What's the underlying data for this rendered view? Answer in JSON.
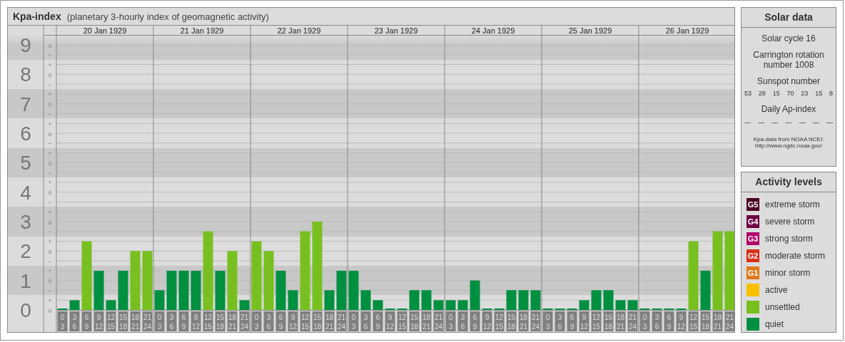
{
  "title": "Kpa-index",
  "subtitle": "(planetary 3-hourly index of geomagnetic activity)",
  "chart": {
    "days": [
      "20 Jan 1929",
      "21 Jan 1929",
      "22 Jan 1929",
      "23 Jan 1929",
      "24 Jan 1929",
      "25 Jan 1929",
      "26 Jan 1929"
    ],
    "scale_marks": [
      "o",
      "−",
      "+",
      "o",
      "−",
      "+",
      "o",
      "−",
      "+",
      "o",
      "−",
      "+",
      "o",
      "−",
      "+",
      "o",
      "−",
      "+",
      "o",
      "−",
      "+",
      "o",
      "−",
      "+",
      "o",
      "−",
      "+",
      "o"
    ],
    "chart_data": {
      "type": "bar",
      "stacked": true,
      "grid": true,
      "ylim": [
        0,
        9
      ],
      "yticks": [
        0,
        1,
        2,
        3,
        4,
        5,
        6,
        7,
        8,
        9
      ],
      "categories": [
        "0 3",
        "3 6",
        "6 9",
        "9 12",
        "12 15",
        "15 18",
        "18 21",
        "21 24",
        "0 3",
        "3 6",
        "6 9",
        "9 12",
        "12 15",
        "15 18",
        "18 21",
        "21 24",
        "0 3",
        "3 6",
        "6 9",
        "9 12",
        "12 15",
        "15 18",
        "18 21",
        "21 24",
        "0 3",
        "3 6",
        "6 9",
        "9 12",
        "12 15",
        "15 18",
        "18 21",
        "21 24",
        "0 3",
        "3 6",
        "6 9",
        "9 12",
        "12 15",
        "15 18",
        "18 21",
        "21 24",
        "0 3",
        "3 6",
        "6 9",
        "9 12",
        "12 15",
        "15 18",
        "18 21",
        "21 24",
        "0 3",
        "3 6",
        "6 9",
        "9 12",
        "12 15",
        "15 18",
        "18 21",
        "21 24"
      ],
      "series": [
        {
          "color": "#009040",
          "values": [
            0,
            0.33,
            null,
            1.33,
            0.33,
            1.33,
            null,
            null,
            0.67,
            1.33,
            1.33,
            1.33,
            null,
            1.33,
            null,
            0.33,
            null,
            null,
            1.33,
            0.67,
            null,
            null,
            0.67,
            1.33,
            1.33,
            0.67,
            0.33,
            0,
            0,
            0.67,
            0.67,
            0.33,
            0.33,
            0.33,
            1,
            0,
            0,
            0.67,
            0.67,
            0.67,
            0,
            0,
            0,
            0.33,
            0.67,
            0.67,
            0.33,
            0.33,
            0,
            0,
            0,
            0,
            null,
            1.33,
            null,
            null
          ]
        },
        {
          "color": "#78c020",
          "values": [
            null,
            null,
            2.33,
            null,
            null,
            null,
            2,
            2,
            null,
            null,
            null,
            null,
            2.67,
            null,
            2,
            null,
            2.33,
            2,
            null,
            null,
            2.67,
            3,
            null,
            null,
            null,
            null,
            null,
            null,
            null,
            null,
            null,
            null,
            null,
            null,
            null,
            null,
            null,
            null,
            null,
            null,
            null,
            null,
            null,
            null,
            null,
            null,
            null,
            null,
            null,
            null,
            null,
            null,
            2.33,
            null,
            2.67,
            2.67
          ]
        }
      ]
    }
  },
  "solar": {
    "title": "Solar data",
    "cycle": "Solar cycle 16",
    "rotation": "Carrington rotation number 1008",
    "sunspot_title": "Sunspot number",
    "sunspots": [
      "53",
      "28",
      "15",
      "70",
      "23",
      "15",
      "8"
    ],
    "ap_title": "Daily Ap-index",
    "ap_values": [
      "—",
      "—",
      "—",
      "—",
      "—",
      "—",
      "—"
    ],
    "source": [
      "Kpa-data from NOAA NCEI:",
      "http://www.ngdc.noaa.gov/"
    ]
  },
  "legend": {
    "title": "Activity levels",
    "items": [
      {
        "badge": "G5",
        "label": "extreme storm",
        "color": "#4a0022"
      },
      {
        "badge": "G4",
        "label": "severe storm",
        "color": "#6e0040"
      },
      {
        "badge": "G3",
        "label": "strong storm",
        "color": "#b0006a"
      },
      {
        "badge": "G2",
        "label": "moderate storm",
        "color": "#d8301a"
      },
      {
        "badge": "G1",
        "label": "minor storm",
        "color": "#e07818"
      },
      {
        "label": "active",
        "color": "#f8c000"
      },
      {
        "label": "unsettled",
        "color": "#78c020"
      },
      {
        "label": "quiet",
        "color": "#009040"
      }
    ]
  }
}
